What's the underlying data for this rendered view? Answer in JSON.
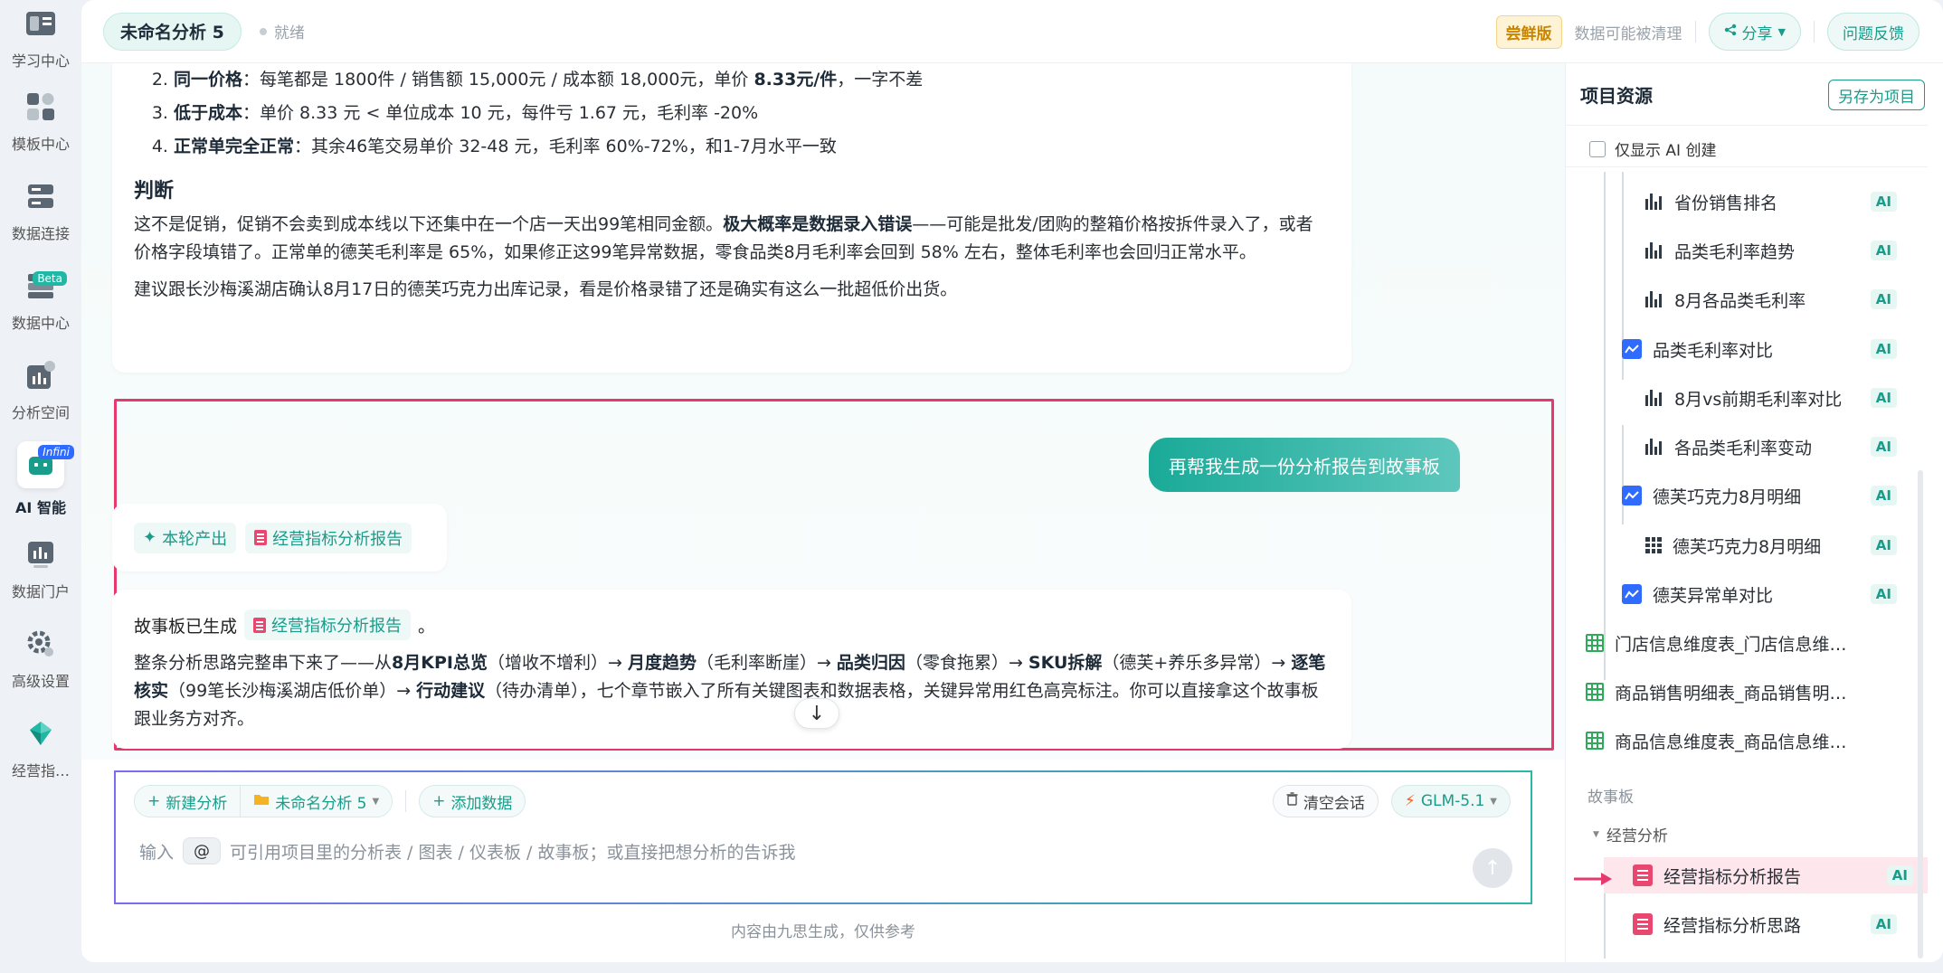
{
  "nav": [
    {
      "label": "学习中心",
      "icon": "book-icon"
    },
    {
      "label": "模板中心",
      "icon": "template-icon"
    },
    {
      "label": "数据连接",
      "icon": "database-connect-icon"
    },
    {
      "label": "数据中心",
      "icon": "data-center-icon",
      "badge": "Beta"
    },
    {
      "label": "分析空间",
      "icon": "analysis-icon"
    },
    {
      "label": "AI 智能",
      "icon": "robot-icon",
      "badge": "Infini",
      "active": true
    },
    {
      "label": "数据门户",
      "icon": "portal-icon"
    },
    {
      "label": "高级设置",
      "icon": "gear-icon"
    },
    {
      "label": "经营指…",
      "icon": "diamond-logo-icon"
    }
  ],
  "topbar": {
    "title": "未命名分析 5",
    "status": "就绪",
    "trial": "尝鲜版",
    "trial_note": "数据可能被清理",
    "share": "分享",
    "feedback": "问题反馈"
  },
  "card1": {
    "li2_label": "同一价格",
    "li2_text1": "：每笔都是 1800件 / 销售额 15,000元 / 成本额 18,000元，单价 ",
    "li2_bold": "8.33元/件",
    "li2_text2": "，一字不差",
    "li3_label": "低于成本",
    "li3_text": "：单价 8.33 元 < 单位成本 10 元，每件亏 1.67 元，毛利率 -20%",
    "li4_label": "正常单完全正常",
    "li4_text": "：其余46笔交易单价 32-48 元，毛利率 60%-72%，和1-7月水平一致",
    "heading": "判断",
    "p1_a": "这不是促销，促销不会卖到成本线以下还集中在一个店一天出99笔相同金额。",
    "p1_bold": "极大概率是数据录入错误",
    "p1_b": "——可能是批发/团购的整箱价格按拆件录入了，或者价格字段填错了。正常单的德芙毛利率是 65%，如果修正这99笔异常数据，零食品类8月毛利率会回到 58% 左右，整体毛利率也会回归正常水平。",
    "p2": "建议跟长沙梅溪湖店确认8月17日的德芙巧克力出库记录，看是价格录错了还是确实有这么一批超低价出货。"
  },
  "user_message": "再帮我生成一份分析报告到故事板",
  "round": {
    "tag": "本轮产出",
    "doc": "经营指标分析报告"
  },
  "reply": {
    "line1": "故事板已生成",
    "doc": "经营指标分析报告",
    "line1_end": "。",
    "p_a": "整条分析思路完整串下来了——从",
    "s1": "8月KPI总览",
    "s1n": "（增收不增利）→ ",
    "s2": "月度趋势",
    "s2n": "（毛利率断崖）→ ",
    "s3": "品类归因",
    "s3n": "（零食拖累）→ ",
    "s4": "SKU拆解",
    "s4n": "（德芙+养乐多异常）→ ",
    "s5": "逐笔核实",
    "s5n": "（99笔长沙梅溪湖店低价单）→ ",
    "s6": "行动建议",
    "s6n": "（待办清单），七个章节嵌入了所有关键图表和数据表格，关键异常用红色高亮标注。你可以直接拿这个故事板跟业务方对齐。",
    "scroll_glyph": "↓"
  },
  "composer": {
    "new_analysis": "新建分析",
    "analysis_name": "未命名分析 5",
    "add_data": "添加数据",
    "clear": "清空会话",
    "model": "GLM-5.1",
    "placeholder_pre": "输入",
    "at": "@",
    "placeholder_post": "可引用项目里的分析表 / 图表 / 仪表板 / 故事板；或直接把想分析的告诉我",
    "send_glyph": "↑"
  },
  "disclaimer": "内容由九思生成，仅供参考",
  "resources": {
    "title": "项目资源",
    "save_as": "另存为项目",
    "filter": "仅显示 AI 创建",
    "ai_tag": "AI",
    "items": [
      {
        "label": "省份销售排名",
        "icon": "bar-chart-icon",
        "ai": true
      },
      {
        "label": "品类毛利率趋势",
        "icon": "bar-chart-icon",
        "ai": true
      },
      {
        "label": "8月各品类毛利率",
        "icon": "bar-chart-icon",
        "ai": true
      },
      {
        "label": "品类毛利率对比",
        "icon": "line-chart-icon",
        "ai": true
      },
      {
        "label": "8月vs前期毛利率对比",
        "icon": "bar-chart-icon",
        "ai": true
      },
      {
        "label": "各品类毛利率变动",
        "icon": "bar-chart-icon",
        "ai": true
      },
      {
        "label": "德芙巧克力8月明细",
        "icon": "line-chart-icon",
        "ai": true
      },
      {
        "label": "德芙巧克力8月明细",
        "icon": "table-icon",
        "ai": true
      },
      {
        "label": "德芙异常单对比",
        "icon": "line-chart-icon",
        "ai": true
      },
      {
        "label": "门店信息维度表_门店信息维…",
        "icon": "sheet-icon",
        "ai": false
      },
      {
        "label": "商品销售明细表_商品销售明…",
        "icon": "sheet-icon",
        "ai": false
      },
      {
        "label": "商品信息维度表_商品信息维…",
        "icon": "sheet-icon",
        "ai": false
      }
    ],
    "storyboard_section": "故事板",
    "folder": "经营分析",
    "stories": [
      {
        "label": "经营指标分析报告",
        "selected": true
      },
      {
        "label": "经营指标分析思路",
        "selected": false
      }
    ]
  },
  "colors": {
    "accent": "#1a9c8a",
    "highlight": "#e63a6e",
    "selected_bg": "#fde6ec"
  }
}
